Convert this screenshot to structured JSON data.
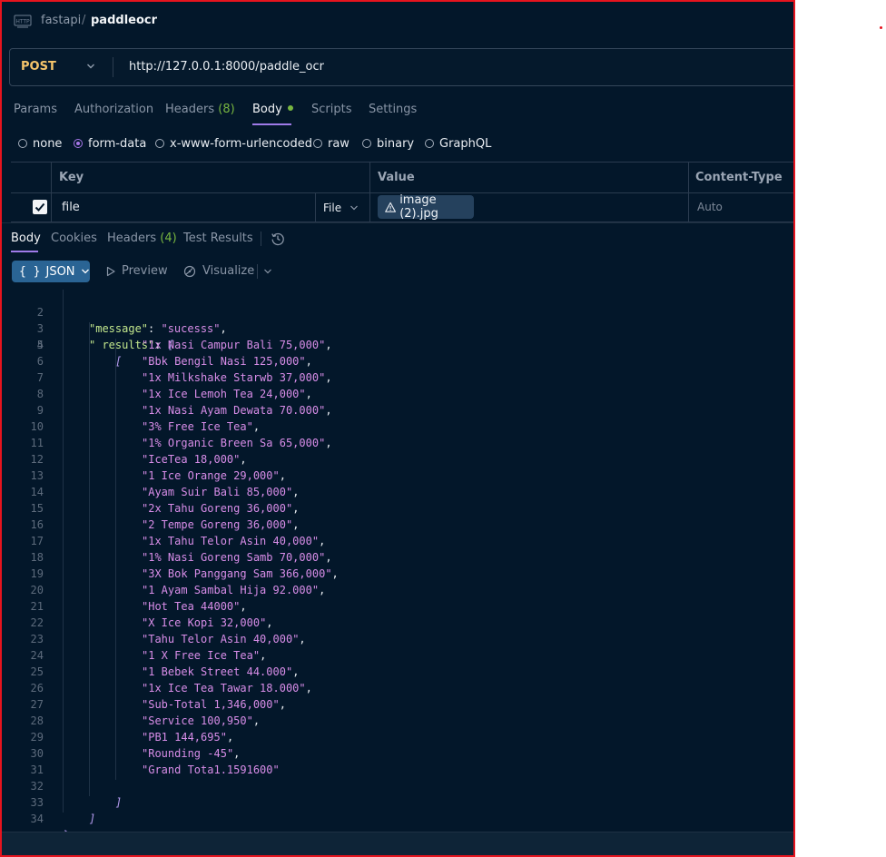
{
  "breadcrumb": {
    "collection": "fastapi",
    "separator": "/",
    "request": "paddleocr"
  },
  "request": {
    "method": "POST",
    "url": "http://127.0.0.1:8000/paddle_ocr",
    "tabs": [
      {
        "label": "Params"
      },
      {
        "label": "Authorization"
      },
      {
        "label": "Headers",
        "count": "(8)"
      },
      {
        "label": "Body"
      },
      {
        "label": "Scripts"
      },
      {
        "label": "Settings"
      }
    ],
    "body_types": [
      "none",
      "form-data",
      "x-www-form-urlencoded",
      "raw",
      "binary",
      "GraphQL"
    ],
    "body_selected": "form-data",
    "table": {
      "headers": [
        "Key",
        "Value",
        "Content-Type"
      ],
      "row": {
        "key": "file",
        "type": "File",
        "value": "image (2).jpg",
        "content_type": "Auto",
        "checked": true
      }
    }
  },
  "response": {
    "tabs": [
      {
        "label": "Body"
      },
      {
        "label": "Cookies"
      },
      {
        "label": "Headers",
        "count": "(4)"
      },
      {
        "label": "Test Results"
      }
    ],
    "format": "JSON",
    "tools": [
      "Preview",
      "Visualize"
    ],
    "message_key": "\"message\"",
    "message_value": "\"sucesss\"",
    "results_key": "\" results\"",
    "results": [
      "1x Nasi Campur Bali 75,000",
      "Bbk Bengil Nasi 125,000",
      "1x Milkshake Starwb 37,000",
      "1x Ice Lemoh Tea 24,000",
      "1x Nasi Ayam Dewata 70.000",
      "3% Free Ice Tea",
      "1% Organic Breen Sa 65,000",
      "IceTea 18,000",
      "1 Ice Orange 29,000",
      "Ayam Suir Bali 85,000",
      "2x Tahu Goreng 36,000",
      "2 Tempe Goreng 36,000",
      "1x Tahu Telor Asin 40,000",
      "1% Nasi Goreng Samb 70,000",
      "3X Bok Panggang Sam 366,000",
      "1 Ayam Sambal Hija 92.000",
      "Hot Tea 44000",
      "X Ice Kopi 32,000",
      "Tahu Telor Asin 40,000",
      "1 X Free Ice Tea",
      "1 Bebek Street 44.000",
      "1x Ice Tea Tawar 18.000",
      "Sub-Total 1,346,000",
      "Service 100,950",
      "PB1 144,695",
      "Rounding -45",
      "Grand Tota1.1591600"
    ]
  },
  "colors": {
    "background": "#03172a",
    "accent": "#9f7ae8",
    "method": "#f6c56b",
    "json_key": "#c3e88d",
    "json_string": "#d88de8",
    "count": "#78b640"
  }
}
